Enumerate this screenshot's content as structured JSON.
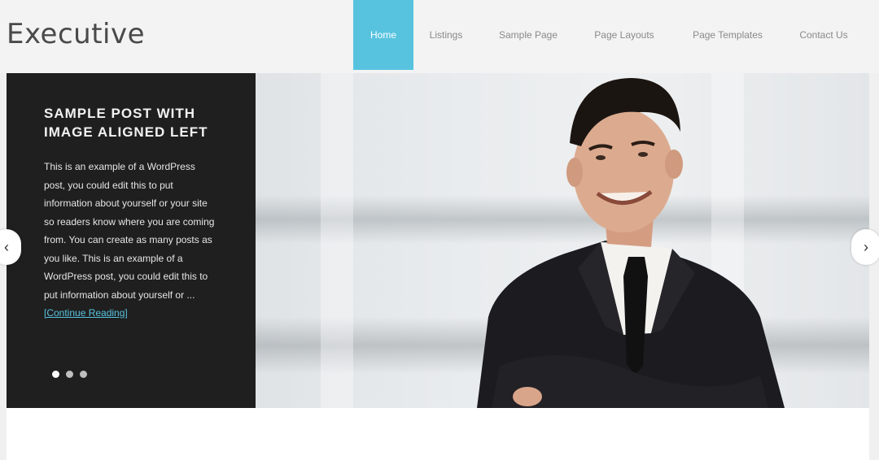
{
  "header": {
    "logo": "Executive",
    "nav": [
      {
        "label": "Home",
        "active": true
      },
      {
        "label": "Listings"
      },
      {
        "label": "Sample Page"
      },
      {
        "label": "Page Layouts"
      },
      {
        "label": "Page Templates"
      },
      {
        "label": "Contact Us"
      }
    ]
  },
  "slider": {
    "caption_title": "Sample Post With Image Aligned Left",
    "caption_body": "This is an example of a WordPress post, you could edit this to put information about yourself or your site so readers know where you are coming from. You can create as many posts as you like. This is an example of a WordPress post, you could edit this to put information about yourself or ...",
    "caption_more": "[Continue Reading]",
    "prev_glyph": "‹",
    "next_glyph": "›"
  },
  "colors": {
    "accent": "#57c3df",
    "caption_bg": "#1f1f1f"
  }
}
